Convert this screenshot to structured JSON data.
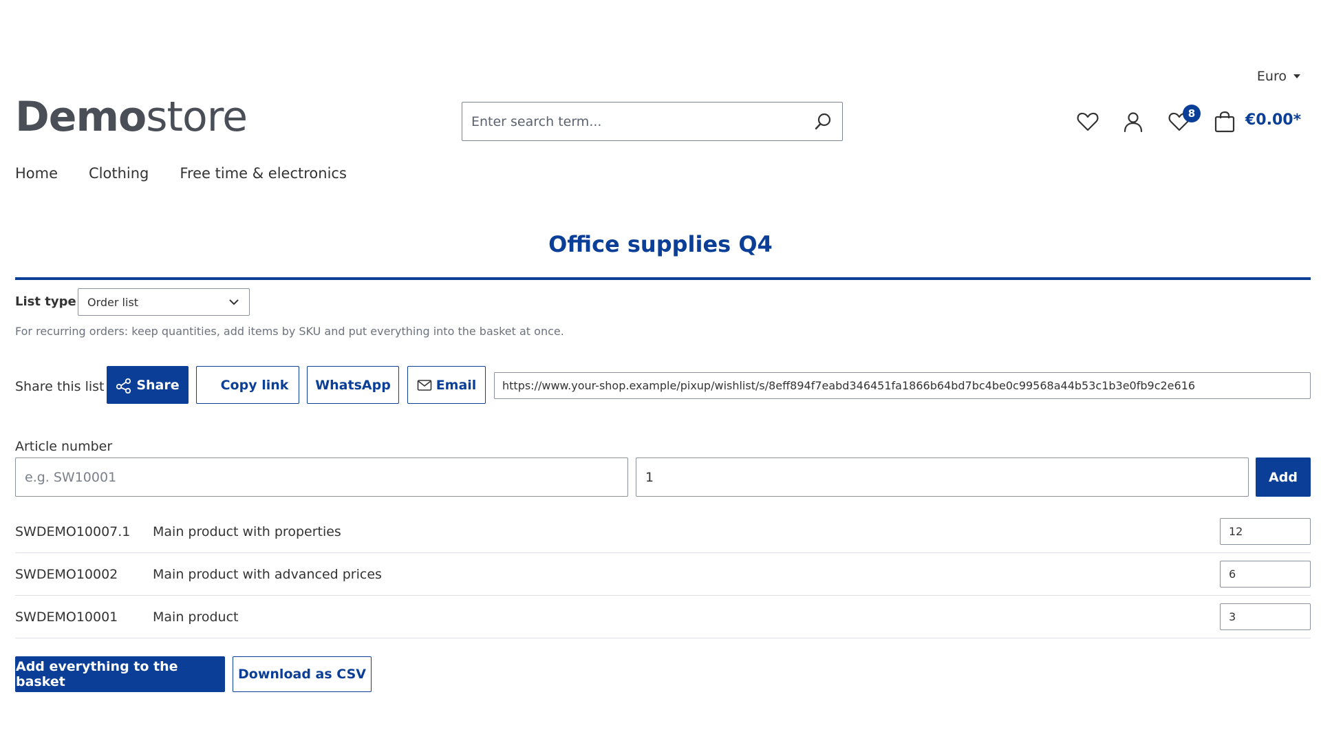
{
  "header": {
    "currency": "Euro",
    "logo_bold": "Demo",
    "logo_light": "store",
    "search_placeholder": "Enter search term...",
    "wishlist_badge": "8",
    "cart_total": "€0.00*"
  },
  "nav": {
    "items": [
      "Home",
      "Clothing",
      "Free time & electronics"
    ]
  },
  "page": {
    "title": "Office supplies Q4",
    "list_type_label": "List type",
    "list_type_value": "Order list",
    "hint": "For recurring orders: keep quantities, add items by SKU and put everything into the basket at once."
  },
  "share": {
    "label": "Share this list",
    "share_button": "Share",
    "copy_link_button": "Copy link",
    "whatsapp_button": "WhatsApp",
    "email_button": "Email",
    "url": "https://www.your-shop.example/pixup/wishlist/s/8eff894f7eabd346451fa1866b64bd7bc4be0c99568a44b53c1b3e0fb9c2e616"
  },
  "quick_add": {
    "article_label": "Article number",
    "article_placeholder": "e.g. SW10001",
    "quantity_value": "1",
    "add_button": "Add"
  },
  "items": [
    {
      "sku": "SWDEMO10007.1",
      "name": "Main product with properties",
      "qty": "12"
    },
    {
      "sku": "SWDEMO10002",
      "name": "Main product with advanced prices",
      "qty": "6"
    },
    {
      "sku": "SWDEMO10001",
      "name": "Main product",
      "qty": "3"
    }
  ],
  "actions": {
    "add_all_button": "Add everything to the basket",
    "download_csv_button": "Download as CSV"
  },
  "colors": {
    "accent": "#0b3e96",
    "text": "#333333",
    "muted": "#6c727c"
  }
}
